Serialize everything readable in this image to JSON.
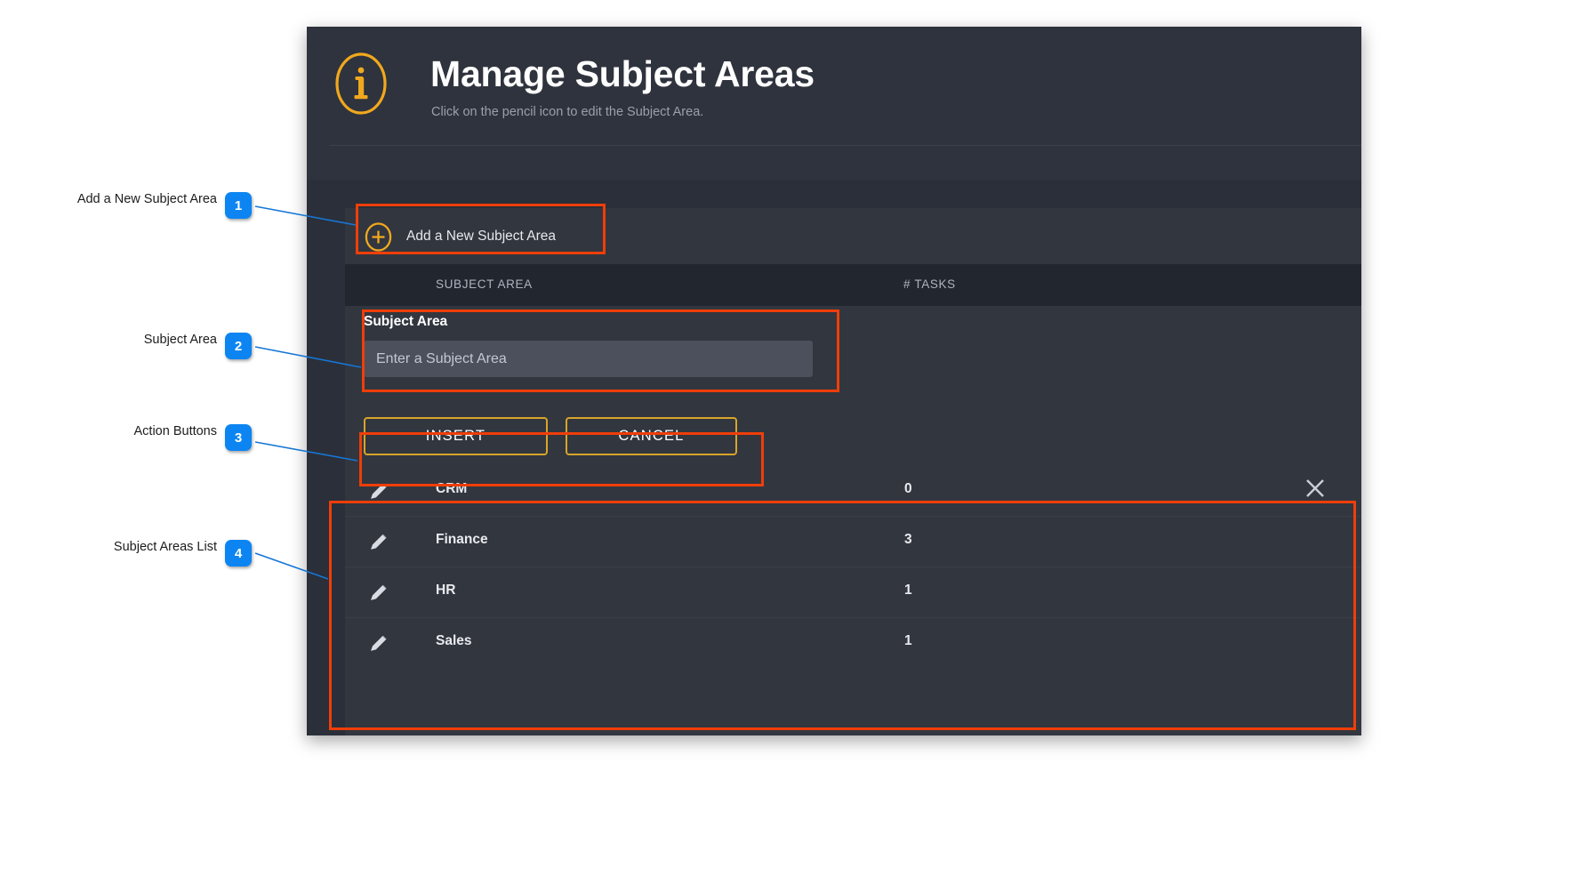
{
  "window": {
    "header": {
      "icon": "info-circle-icon",
      "title": "Manage Subject Areas",
      "subtitle": "Click on the pencil icon to edit the Subject Area."
    },
    "add_button": {
      "icon": "plus-circle-icon",
      "label": "Add a New Subject Area"
    },
    "table": {
      "columns": [
        "SUBJECT AREA",
        "# TASKS"
      ],
      "rows": [
        {
          "edit_icon": "pencil-icon",
          "name": "CRM",
          "tasks": "0",
          "close_icon": "close-icon"
        },
        {
          "edit_icon": "pencil-icon",
          "name": "Finance",
          "tasks": "3"
        },
        {
          "edit_icon": "pencil-icon",
          "name": "HR",
          "tasks": "1"
        },
        {
          "edit_icon": "pencil-icon",
          "name": "Sales",
          "tasks": "1"
        }
      ]
    },
    "form": {
      "label": "Subject Area",
      "input_value": "",
      "input_placeholder": "Enter a Subject Area",
      "insert_label": "INSERT",
      "cancel_label": "CANCEL"
    }
  },
  "annotations": [
    {
      "number": "1",
      "label": "Add a New Subject Area"
    },
    {
      "number": "2",
      "label": "Subject  Area"
    },
    {
      "number": "3",
      "label": "Action Buttons"
    },
    {
      "number": "4",
      "label": "Subject Areas List"
    }
  ],
  "colors": {
    "accent_orange": "#f0a81e",
    "annotation_box": "#ef3e09",
    "annotation_badge": "#0c85f2",
    "panel_bg": "#2f333d",
    "card_bg": "#32363f",
    "table_head_bg": "#22262e"
  }
}
